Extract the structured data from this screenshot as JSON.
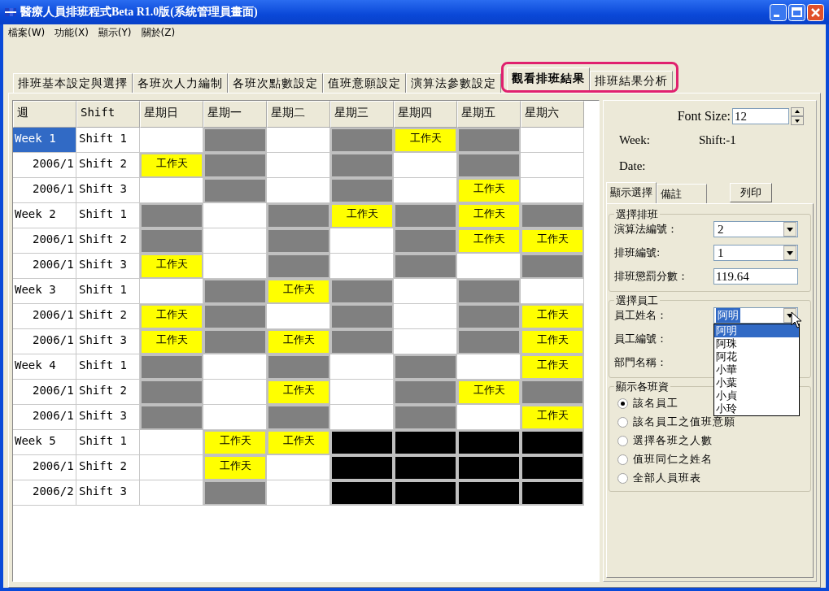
{
  "window": {
    "title": "醫療人員排班程式Beta R1.0版(系統管理員畫面)"
  },
  "menu": [
    "檔案(W)",
    "功能(X)",
    "顯示(Y)",
    "關於(Z)"
  ],
  "tabs": [
    {
      "label": "排班基本設定與選擇",
      "selected": false,
      "highlighted": false
    },
    {
      "label": "各班次人力編制",
      "selected": false,
      "highlighted": false
    },
    {
      "label": "各班次點數設定",
      "selected": false,
      "highlighted": false
    },
    {
      "label": "值班意願設定",
      "selected": false,
      "highlighted": false
    },
    {
      "label": "演算法參數設定",
      "selected": false,
      "highlighted": false
    },
    {
      "label": "觀看排班結果",
      "selected": true,
      "highlighted": true
    },
    {
      "label": "排班結果分析",
      "selected": false,
      "highlighted": true
    }
  ],
  "grid": {
    "columns": [
      "週",
      "Shift",
      "星期日",
      "星期一",
      "星期二",
      "星期三",
      "星期四",
      "星期五",
      "星期六"
    ],
    "rows": [
      {
        "selected": true,
        "cells": [
          {
            "kind": "label",
            "text": "Week 1"
          },
          {
            "kind": "label",
            "text": "Shift 1"
          },
          {
            "kind": "open"
          },
          {
            "kind": "off"
          },
          {
            "kind": "open"
          },
          {
            "kind": "off"
          },
          {
            "kind": "work",
            "text": "工作天"
          },
          {
            "kind": "off"
          },
          {
            "kind": "open"
          }
        ]
      },
      {
        "selected": false,
        "cells": [
          {
            "kind": "label",
            "text": "2006/1"
          },
          {
            "kind": "label",
            "text": "Shift 2"
          },
          {
            "kind": "work",
            "text": "工作天"
          },
          {
            "kind": "off"
          },
          {
            "kind": "open"
          },
          {
            "kind": "off"
          },
          {
            "kind": "open"
          },
          {
            "kind": "off"
          },
          {
            "kind": "open"
          }
        ]
      },
      {
        "selected": false,
        "cells": [
          {
            "kind": "label",
            "text": "2006/1"
          },
          {
            "kind": "label",
            "text": "Shift 3"
          },
          {
            "kind": "open"
          },
          {
            "kind": "off"
          },
          {
            "kind": "open"
          },
          {
            "kind": "off"
          },
          {
            "kind": "open"
          },
          {
            "kind": "work",
            "text": "工作天"
          },
          {
            "kind": "open"
          }
        ]
      },
      {
        "selected": false,
        "cells": [
          {
            "kind": "label",
            "text": "Week 2"
          },
          {
            "kind": "label",
            "text": "Shift 1"
          },
          {
            "kind": "off"
          },
          {
            "kind": "open"
          },
          {
            "kind": "off"
          },
          {
            "kind": "work",
            "text": "工作天"
          },
          {
            "kind": "off"
          },
          {
            "kind": "work",
            "text": "工作天"
          },
          {
            "kind": "off"
          }
        ]
      },
      {
        "selected": false,
        "cells": [
          {
            "kind": "label",
            "text": "2006/1"
          },
          {
            "kind": "label",
            "text": "Shift 2"
          },
          {
            "kind": "off"
          },
          {
            "kind": "open"
          },
          {
            "kind": "off"
          },
          {
            "kind": "open"
          },
          {
            "kind": "off"
          },
          {
            "kind": "work",
            "text": "工作天"
          },
          {
            "kind": "work",
            "text": "工作天"
          }
        ]
      },
      {
        "selected": false,
        "cells": [
          {
            "kind": "label",
            "text": "2006/1"
          },
          {
            "kind": "label",
            "text": "Shift 3"
          },
          {
            "kind": "work",
            "text": "工作天"
          },
          {
            "kind": "open"
          },
          {
            "kind": "off"
          },
          {
            "kind": "open"
          },
          {
            "kind": "off"
          },
          {
            "kind": "open"
          },
          {
            "kind": "off"
          }
        ]
      },
      {
        "selected": false,
        "cells": [
          {
            "kind": "label",
            "text": "Week 3"
          },
          {
            "kind": "label",
            "text": "Shift 1"
          },
          {
            "kind": "open"
          },
          {
            "kind": "off"
          },
          {
            "kind": "work",
            "text": "工作天"
          },
          {
            "kind": "off"
          },
          {
            "kind": "open"
          },
          {
            "kind": "off"
          },
          {
            "kind": "open"
          }
        ]
      },
      {
        "selected": false,
        "cells": [
          {
            "kind": "label",
            "text": "2006/1"
          },
          {
            "kind": "label",
            "text": "Shift 2"
          },
          {
            "kind": "work",
            "text": "工作天"
          },
          {
            "kind": "off"
          },
          {
            "kind": "open"
          },
          {
            "kind": "off"
          },
          {
            "kind": "open"
          },
          {
            "kind": "off"
          },
          {
            "kind": "work",
            "text": "工作天"
          }
        ]
      },
      {
        "selected": false,
        "cells": [
          {
            "kind": "label",
            "text": "2006/1"
          },
          {
            "kind": "label",
            "text": "Shift 3"
          },
          {
            "kind": "work",
            "text": "工作天"
          },
          {
            "kind": "off"
          },
          {
            "kind": "work",
            "text": "工作天"
          },
          {
            "kind": "off"
          },
          {
            "kind": "open"
          },
          {
            "kind": "off"
          },
          {
            "kind": "work",
            "text": "工作天"
          }
        ]
      },
      {
        "selected": false,
        "cells": [
          {
            "kind": "label",
            "text": "Week 4"
          },
          {
            "kind": "label",
            "text": "Shift 1"
          },
          {
            "kind": "off"
          },
          {
            "kind": "open"
          },
          {
            "kind": "off"
          },
          {
            "kind": "open"
          },
          {
            "kind": "off"
          },
          {
            "kind": "open"
          },
          {
            "kind": "work",
            "text": "工作天"
          }
        ]
      },
      {
        "selected": false,
        "cells": [
          {
            "kind": "label",
            "text": "2006/1"
          },
          {
            "kind": "label",
            "text": "Shift 2"
          },
          {
            "kind": "off"
          },
          {
            "kind": "open"
          },
          {
            "kind": "work",
            "text": "工作天"
          },
          {
            "kind": "open"
          },
          {
            "kind": "off"
          },
          {
            "kind": "work",
            "text": "工作天"
          },
          {
            "kind": "off"
          }
        ]
      },
      {
        "selected": false,
        "cells": [
          {
            "kind": "label",
            "text": "2006/1"
          },
          {
            "kind": "label",
            "text": "Shift 3"
          },
          {
            "kind": "off"
          },
          {
            "kind": "open"
          },
          {
            "kind": "off"
          },
          {
            "kind": "open"
          },
          {
            "kind": "off"
          },
          {
            "kind": "open"
          },
          {
            "kind": "work",
            "text": "工作天"
          }
        ]
      },
      {
        "selected": false,
        "cells": [
          {
            "kind": "label",
            "text": "Week 5"
          },
          {
            "kind": "label",
            "text": "Shift 1"
          },
          {
            "kind": "open"
          },
          {
            "kind": "work",
            "text": "工作天"
          },
          {
            "kind": "work",
            "text": "工作天"
          },
          {
            "kind": "none"
          },
          {
            "kind": "none"
          },
          {
            "kind": "none"
          },
          {
            "kind": "none"
          }
        ]
      },
      {
        "selected": false,
        "cells": [
          {
            "kind": "label",
            "text": "2006/1"
          },
          {
            "kind": "label",
            "text": "Shift 2"
          },
          {
            "kind": "open"
          },
          {
            "kind": "work",
            "text": "工作天"
          },
          {
            "kind": "open"
          },
          {
            "kind": "none"
          },
          {
            "kind": "none"
          },
          {
            "kind": "none"
          },
          {
            "kind": "none"
          }
        ]
      },
      {
        "selected": false,
        "cells": [
          {
            "kind": "label",
            "text": "2006/2"
          },
          {
            "kind": "label",
            "text": "Shift 3"
          },
          {
            "kind": "open"
          },
          {
            "kind": "off"
          },
          {
            "kind": "open"
          },
          {
            "kind": "none"
          },
          {
            "kind": "none"
          },
          {
            "kind": "none"
          },
          {
            "kind": "none"
          }
        ]
      }
    ]
  },
  "font_size": {
    "label": "Font Size:",
    "value": "12"
  },
  "info": {
    "week": "Week:",
    "shift": "Shift:-1",
    "date": "Date:"
  },
  "side_tabs": [
    {
      "label": "顯示選擇",
      "selected": true
    },
    {
      "label": "備註",
      "selected": false
    }
  ],
  "print_button": "列印",
  "schedule_group": {
    "title": "選擇排班",
    "fields": [
      {
        "kind": "combo",
        "label": "演算法編號：",
        "value": "2"
      },
      {
        "kind": "combo",
        "label": "排班編號:",
        "value": "1"
      },
      {
        "kind": "text",
        "label": "排班懲罰分數：",
        "value": "119.64"
      }
    ]
  },
  "employee_group": {
    "title": "選擇員工",
    "fields": [
      {
        "kind": "combo",
        "label": "員工姓名：",
        "value": "阿明",
        "value_selected": true,
        "open": true
      },
      {
        "kind": "label",
        "label": "員工編號："
      },
      {
        "kind": "label",
        "label": "部門名稱："
      }
    ],
    "dropdown": [
      {
        "label": "阿明",
        "selected": true
      },
      {
        "label": "阿珠",
        "selected": false
      },
      {
        "label": "阿花",
        "selected": false
      },
      {
        "label": "小華",
        "selected": false
      },
      {
        "label": "小葉",
        "selected": false
      },
      {
        "label": "小貞",
        "selected": false
      },
      {
        "label": "小玲",
        "selected": false
      }
    ]
  },
  "display_group": {
    "title": "顯示各班資",
    "options": [
      {
        "label": "該名員工",
        "selected": true
      },
      {
        "label": "該名員工之值班意願",
        "selected": false
      },
      {
        "label": "選擇各班之人數",
        "selected": false
      },
      {
        "label": "值班同仁之姓名",
        "selected": false
      },
      {
        "label": "全部人員班表",
        "selected": false
      }
    ]
  }
}
